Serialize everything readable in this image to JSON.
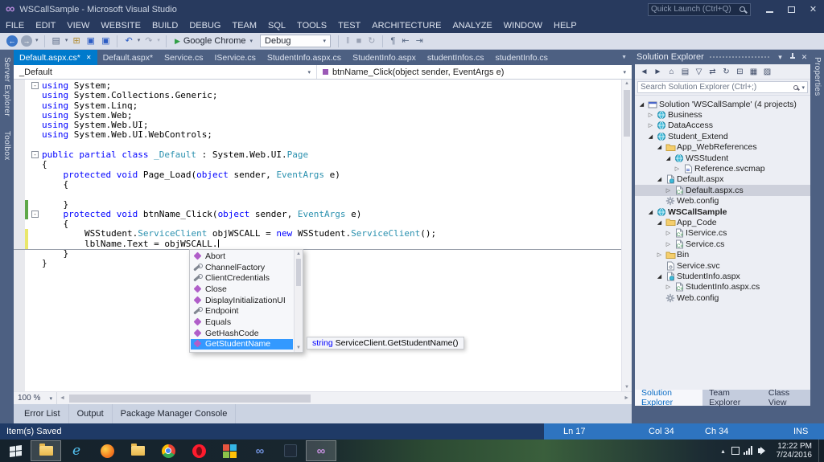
{
  "window": {
    "title": "WSCallSample - Microsoft Visual Studio",
    "quick_launch_placeholder": "Quick Launch (Ctrl+Q)"
  },
  "menu": [
    "FILE",
    "EDIT",
    "VIEW",
    "WEBSITE",
    "BUILD",
    "DEBUG",
    "TEAM",
    "SQL",
    "TOOLS",
    "TEST",
    "ARCHITECTURE",
    "ANALYZE",
    "WINDOW",
    "HELP"
  ],
  "toolbar": {
    "run_target": "Google Chrome",
    "configuration": "Debug"
  },
  "toolbar_items": [
    {
      "name": "navigate-backward",
      "glyph": "←",
      "cls": "circ cblue"
    },
    {
      "name": "navigate-forward",
      "glyph": "→",
      "cls": "circ cgray"
    },
    {
      "name": "navigate-history",
      "glyph": "▾",
      "cls": "chev"
    },
    {
      "type": "sep"
    },
    {
      "name": "new-file",
      "glyph": "▤",
      "cls": "cink"
    },
    {
      "name": "new-file-options",
      "glyph": "▾",
      "cls": "chev"
    },
    {
      "name": "open-file",
      "glyph": "⊞",
      "cls": "cyellow"
    },
    {
      "name": "save",
      "glyph": "▣",
      "cls": "csave"
    },
    {
      "name": "save-all",
      "glyph": "▣",
      "cls": "csave"
    },
    {
      "type": "sep"
    },
    {
      "name": "undo",
      "glyph": "↶",
      "cls": "cundo"
    },
    {
      "name": "undo-options",
      "glyph": "▾",
      "cls": "chev"
    },
    {
      "name": "redo",
      "glyph": "↷",
      "cls": "dis"
    },
    {
      "name": "redo-options",
      "glyph": "▾",
      "cls": "chev dis"
    },
    {
      "type": "sep"
    },
    {
      "type": "run"
    },
    {
      "type": "combo"
    },
    {
      "type": "sep"
    },
    {
      "name": "break-all",
      "glyph": "‖",
      "cls": "dis"
    },
    {
      "name": "stop-debugging",
      "glyph": "■",
      "cls": "dis"
    },
    {
      "name": "restart-debugging",
      "glyph": "↻",
      "cls": "dis"
    },
    {
      "type": "sep"
    },
    {
      "name": "show-whitespace",
      "glyph": "¶",
      "cls": "cink"
    },
    {
      "name": "decrease-indent",
      "glyph": "⇤",
      "cls": "cink"
    },
    {
      "name": "increase-indent",
      "glyph": "⇥",
      "cls": "cink"
    }
  ],
  "left_tool_tabs": [
    "Server Explorer",
    "Toolbox"
  ],
  "right_tool_tabs": [
    "Properties"
  ],
  "editor": {
    "tabs": [
      {
        "label": "Default.aspx.cs*",
        "active": true
      },
      {
        "label": "Default.aspx*"
      },
      {
        "label": "Service.cs"
      },
      {
        "label": "IService.cs"
      },
      {
        "label": "StudentInfo.aspx.cs"
      },
      {
        "label": "StudentInfo.aspx"
      },
      {
        "label": "studentInfos.cs"
      },
      {
        "label": "studentInfo.cs"
      }
    ],
    "nav": {
      "type": "_Default",
      "member": "btnName_Click(object sender, EventArgs e)"
    },
    "zoom": "100 %",
    "code_lines": [
      {
        "fold": true,
        "seg": [
          [
            "k",
            "using"
          ],
          [
            "p",
            " System;"
          ]
        ]
      },
      {
        "seg": [
          [
            "k",
            "using"
          ],
          [
            "p",
            " System.Collections.Generic;"
          ]
        ]
      },
      {
        "seg": [
          [
            "k",
            "using"
          ],
          [
            "p",
            " System.Linq;"
          ]
        ]
      },
      {
        "seg": [
          [
            "k",
            "using"
          ],
          [
            "p",
            " System.Web;"
          ]
        ]
      },
      {
        "seg": [
          [
            "k",
            "using"
          ],
          [
            "p",
            " System.Web.UI;"
          ]
        ]
      },
      {
        "seg": [
          [
            "k",
            "using"
          ],
          [
            "p",
            " System.Web.UI.WebControls;"
          ]
        ]
      },
      {
        "seg": []
      },
      {
        "fold": true,
        "seg": [
          [
            "k",
            "public partial class"
          ],
          [
            "p",
            " "
          ],
          [
            "y",
            "_Default"
          ],
          [
            "p",
            " : System.Web.UI."
          ],
          [
            "y",
            "Page"
          ]
        ]
      },
      {
        "seg": [
          [
            "p",
            "{"
          ]
        ]
      },
      {
        "seg": [
          [
            "p",
            "    "
          ],
          [
            "k",
            "protected void"
          ],
          [
            "p",
            " Page_Load("
          ],
          [
            "k",
            "object"
          ],
          [
            "p",
            " sender, "
          ],
          [
            "y",
            "EventArgs"
          ],
          [
            "p",
            " e)"
          ]
        ]
      },
      {
        "seg": [
          [
            "p",
            "    {"
          ]
        ]
      },
      {
        "seg": []
      },
      {
        "chg": "g",
        "seg": [
          [
            "p",
            "    }"
          ]
        ]
      },
      {
        "fold": true,
        "chg": "g",
        "seg": [
          [
            "p",
            "    "
          ],
          [
            "k",
            "protected void"
          ],
          [
            "p",
            " btnName_Click("
          ],
          [
            "k",
            "object"
          ],
          [
            "p",
            " sender, "
          ],
          [
            "y",
            "EventArgs"
          ],
          [
            "p",
            " e)"
          ]
        ]
      },
      {
        "seg": [
          [
            "p",
            "    {"
          ]
        ]
      },
      {
        "chg": "y",
        "seg": [
          [
            "p",
            "        WSStudent."
          ],
          [
            "y",
            "ServiceClient"
          ],
          [
            "p",
            " objWSCALL = "
          ],
          [
            "k",
            "new"
          ],
          [
            "p",
            " WSStudent."
          ],
          [
            "y",
            "ServiceClient"
          ],
          [
            "p",
            "();"
          ]
        ]
      },
      {
        "chg": "y",
        "current": true,
        "caret": true,
        "seg": [
          [
            "p",
            "        lblName.Text = objWSCALL."
          ]
        ]
      },
      {
        "seg": [
          [
            "p",
            "    }"
          ]
        ]
      },
      {
        "seg": [
          [
            "p",
            "}"
          ]
        ]
      }
    ]
  },
  "intellisense": {
    "items": [
      {
        "label": "Abort",
        "kind": "method"
      },
      {
        "label": "ChannelFactory",
        "kind": "property"
      },
      {
        "label": "ClientCredentials",
        "kind": "property"
      },
      {
        "label": "Close",
        "kind": "method"
      },
      {
        "label": "DisplayInitializationUI",
        "kind": "method"
      },
      {
        "label": "Endpoint",
        "kind": "property"
      },
      {
        "label": "Equals",
        "kind": "method"
      },
      {
        "label": "GetHashCode",
        "kind": "method"
      },
      {
        "label": "GetStudentName",
        "kind": "method",
        "selected": true
      }
    ],
    "tooltip": {
      "keyword": "string",
      "rest": " ServiceClient.GetStudentName()"
    }
  },
  "solution_explorer": {
    "title": "Solution Explorer",
    "search_placeholder": "Search Solution Explorer (Ctrl+;)",
    "toolbar": [
      {
        "name": "back",
        "glyph": "◄"
      },
      {
        "name": "forward",
        "glyph": "►"
      },
      {
        "name": "home",
        "glyph": "⌂"
      },
      {
        "name": "switch-views",
        "glyph": "▤"
      },
      {
        "name": "pending-changes-filter",
        "glyph": "▽"
      },
      {
        "name": "sync-with-active-document",
        "glyph": "⇄"
      },
      {
        "name": "refresh",
        "glyph": "↻"
      },
      {
        "name": "collapse-all",
        "glyph": "⊟"
      },
      {
        "name": "show-all-files",
        "glyph": "▦"
      },
      {
        "name": "properties",
        "glyph": "▨"
      }
    ],
    "tree": [
      {
        "level": 0,
        "arrow": "exp",
        "icon": "solution",
        "label": "Solution 'WSCallSample' (4 projects)"
      },
      {
        "level": 1,
        "arrow": "col",
        "icon": "project",
        "label": "Business"
      },
      {
        "level": 1,
        "arrow": "col",
        "icon": "project",
        "label": "DataAccess"
      },
      {
        "level": 1,
        "arrow": "exp",
        "icon": "project",
        "label": "Student_Extend"
      },
      {
        "level": 2,
        "arrow": "exp",
        "icon": "folder",
        "label": "App_WebReferences"
      },
      {
        "level": 3,
        "arrow": "exp",
        "icon": "webref",
        "label": "WSStudent"
      },
      {
        "level": 4,
        "arrow": "col",
        "icon": "svcmap",
        "label": "Reference.svcmap"
      },
      {
        "level": 2,
        "arrow": "exp",
        "icon": "page",
        "label": "Default.aspx"
      },
      {
        "level": 3,
        "arrow": "col",
        "icon": "cs",
        "label": "Default.aspx.cs",
        "selected": true
      },
      {
        "level": 2,
        "arrow": "none",
        "icon": "config",
        "label": "Web.config"
      },
      {
        "level": 1,
        "arrow": "exp",
        "icon": "project",
        "label": "WSCallSample",
        "bold": true
      },
      {
        "level": 2,
        "arrow": "exp",
        "icon": "folder",
        "label": "App_Code"
      },
      {
        "level": 3,
        "arrow": "col",
        "icon": "cs",
        "label": "IService.cs"
      },
      {
        "level": 3,
        "arrow": "col",
        "icon": "cs",
        "label": "Service.cs"
      },
      {
        "level": 2,
        "arrow": "col",
        "icon": "folder",
        "label": "Bin"
      },
      {
        "level": 2,
        "arrow": "none",
        "icon": "svc",
        "label": "Service.svc"
      },
      {
        "level": 2,
        "arrow": "exp",
        "icon": "page",
        "label": "StudentInfo.aspx"
      },
      {
        "level": 3,
        "arrow": "col",
        "icon": "cs",
        "label": "StudentInfo.aspx.cs"
      },
      {
        "level": 2,
        "arrow": "none",
        "icon": "config",
        "label": "Web.config"
      }
    ],
    "bottom_tabs": [
      {
        "label": "Solution Explorer",
        "active": true
      },
      {
        "label": "Team Explorer"
      },
      {
        "label": "Class View"
      }
    ]
  },
  "panel_tabs": [
    "Error List",
    "Output",
    "Package Manager Console"
  ],
  "status_bar": {
    "message": "Item(s) Saved",
    "line": "Ln 17",
    "column": "Col 34",
    "character": "Ch 34",
    "mode": "INS"
  },
  "taskbar": {
    "icons": [
      {
        "name": "start"
      },
      {
        "name": "file-explorer",
        "active": true
      },
      {
        "name": "internet-explorer"
      },
      {
        "name": "firefox"
      },
      {
        "name": "folder"
      },
      {
        "name": "chrome"
      },
      {
        "name": "opera"
      },
      {
        "name": "app-tiles"
      },
      {
        "name": "visual-studio-2012"
      },
      {
        "name": "app-dark"
      },
      {
        "name": "visual-studio-2013",
        "active": true
      }
    ],
    "tray_time": "12:22 PM",
    "tray_date": "7/24/2016"
  }
}
